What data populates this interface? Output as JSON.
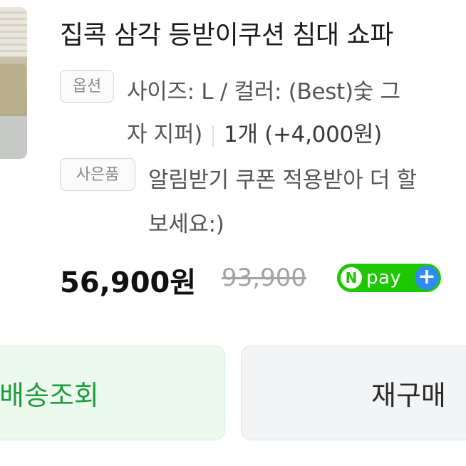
{
  "product": {
    "title": "집콕 삼각 등받이쿠션 침대 쇼파"
  },
  "option": {
    "tag": "옵션",
    "line1": "사이즈: L / 컬러: (Best)숯 그",
    "line2": "자 지퍼)",
    "quantity": "1개 (+4,000원)"
  },
  "gift": {
    "tag": "사은품",
    "line1": "알림받기 쿠폰 적용받아 더 할",
    "line2": "보세요:)"
  },
  "price": {
    "sale": "56,900원",
    "original": "93,900"
  },
  "npay": {
    "n": "N",
    "label": "pay",
    "plus": "+",
    "color": "#1ec800"
  },
  "buttons": {
    "track": "배송조회",
    "rebuy": "재구매"
  },
  "colors": {
    "track_text": "#1d9e3c",
    "track_bg": "#edf8ef",
    "rebuy_bg": "#f3f4f6"
  }
}
